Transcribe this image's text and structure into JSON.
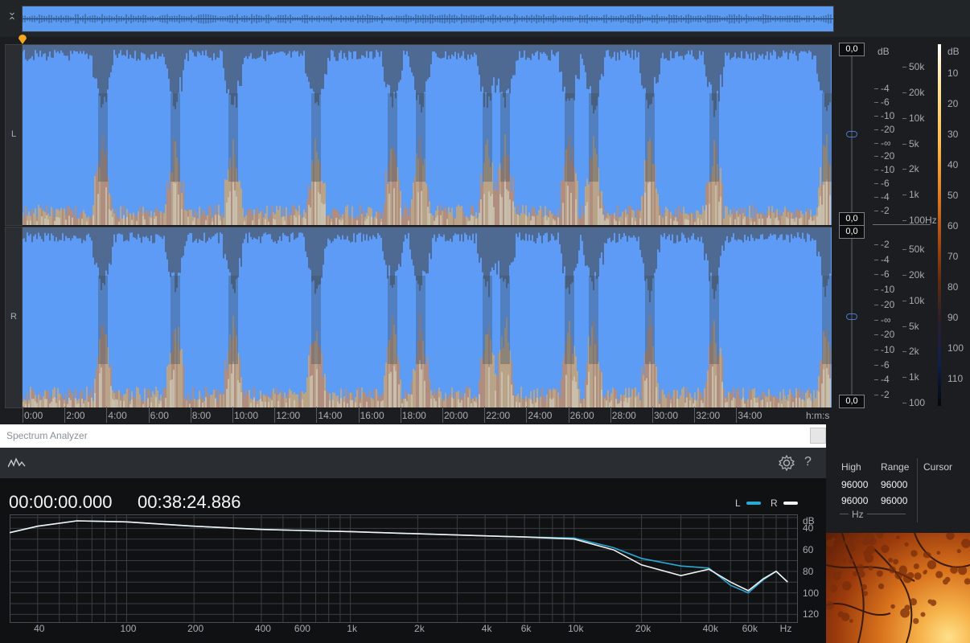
{
  "channels": {
    "left_label": "L",
    "right_label": "R"
  },
  "scale_boxes": [
    "0,0",
    "0,0",
    "0,0",
    "0,0"
  ],
  "amp_scale": {
    "unit": "dB",
    "left": [
      "-4",
      "-6",
      "-10",
      "-20",
      "-∞",
      "-20",
      "-10",
      "-6",
      "-4",
      "-2"
    ],
    "right": [
      "-2",
      "-4",
      "-6",
      "-10",
      "-20",
      "-∞",
      "-20",
      "-10",
      "-6",
      "-4",
      "-2"
    ]
  },
  "freq_scale": {
    "left": [
      "50k",
      "20k",
      "10k",
      "5k",
      "2k",
      "1k",
      "100Hz"
    ],
    "right": [
      "50k",
      "20k",
      "10k",
      "5k",
      "2k",
      "1k",
      "100"
    ]
  },
  "color_legend": {
    "unit": "dB",
    "values": [
      "10",
      "20",
      "30",
      "40",
      "50",
      "60",
      "70",
      "80",
      "90",
      "100",
      "110"
    ]
  },
  "timeline": {
    "labels": [
      "0:00",
      "2:00",
      "4:00",
      "6:00",
      "8:00",
      "10:00",
      "12:00",
      "14:00",
      "16:00",
      "18:00",
      "20:00",
      "22:00",
      "24:00",
      "26:00",
      "28:00",
      "30:00",
      "32:00",
      "34:00"
    ],
    "unit": "h:m:s"
  },
  "spectrum_analyzer": {
    "title": "Spectrum Analyzer",
    "start_time": "00:00:00.000",
    "end_time": "00:38:24.886",
    "legend": [
      {
        "label": "L",
        "color": "#2aa8d6"
      },
      {
        "label": "R",
        "color": "#f2f2f2"
      }
    ],
    "y_unit": "dB",
    "y_labels": [
      "40",
      "60",
      "80",
      "100",
      "120"
    ],
    "x_labels": [
      "40",
      "100",
      "200",
      "400",
      "600",
      "1k",
      "2k",
      "4k",
      "6k",
      "10k",
      "20k",
      "40k",
      "60k",
      "Hz"
    ]
  },
  "side_panel": {
    "headers": [
      "High",
      "Range",
      "Cursor"
    ],
    "rows": [
      [
        "96000",
        "96000"
      ],
      [
        "96000",
        "96000"
      ]
    ],
    "unit": "Hz"
  },
  "colors": {
    "spectrogram_bg": "#5c9cf5",
    "waveform_hot": "#f2b050",
    "accent": "#f0a020"
  },
  "chart_data": {
    "type": "line",
    "xlabel": "Hz",
    "ylabel": "dB",
    "x_scale": "log",
    "ylim": [
      120,
      30
    ],
    "x": [
      30,
      40,
      60,
      100,
      200,
      400,
      600,
      1000,
      2000,
      4000,
      6000,
      10000,
      15000,
      20000,
      30000,
      40000,
      50000,
      60000,
      70000,
      80000,
      90000
    ],
    "series": [
      {
        "name": "L",
        "color": "#2aa8d6",
        "values": [
          44,
          38,
          33,
          34,
          38,
          41,
          42,
          43,
          45,
          47,
          48,
          49,
          58,
          68,
          75,
          77,
          93,
          100,
          88,
          80,
          90
        ]
      },
      {
        "name": "R",
        "color": "#f2f2f2",
        "values": [
          44,
          38,
          33,
          34,
          38,
          41,
          42,
          43,
          45,
          47,
          48,
          50,
          60,
          74,
          84,
          78,
          90,
          98,
          87,
          80,
          90
        ]
      }
    ]
  }
}
